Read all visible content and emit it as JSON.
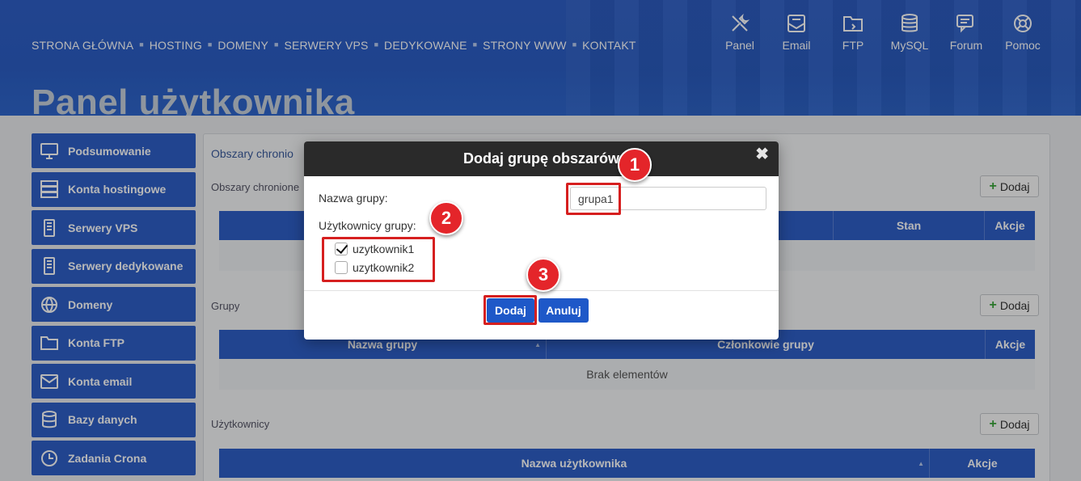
{
  "header": {
    "nav": [
      "STRONA GŁÓWNA",
      "HOSTING",
      "DOMENY",
      "SERWERY VPS",
      "DEDYKOWANE",
      "STRONY WWW",
      "KONTAKT"
    ],
    "icons": [
      {
        "label": "Panel",
        "icon": "tools-icon"
      },
      {
        "label": "Email",
        "icon": "email-icon"
      },
      {
        "label": "FTP",
        "icon": "ftp-folder-icon"
      },
      {
        "label": "MySQL",
        "icon": "database-icon"
      },
      {
        "label": "Forum",
        "icon": "forum-icon"
      },
      {
        "label": "Pomoc",
        "icon": "lifebuoy-icon"
      }
    ],
    "page_title": "Panel użytkownika"
  },
  "sidebar": {
    "items": [
      {
        "label": "Podsumowanie",
        "icon": "monitor-icon"
      },
      {
        "label": "Konta hostingowe",
        "icon": "server-rack-icon"
      },
      {
        "label": "Serwery VPS",
        "icon": "server-icon"
      },
      {
        "label": "Serwery dedykowane",
        "icon": "server-icon"
      },
      {
        "label": "Domeny",
        "icon": "globe-www-icon"
      },
      {
        "label": "Konta FTP",
        "icon": "ftp-folder-icon"
      },
      {
        "label": "Konta email",
        "icon": "email-icon"
      },
      {
        "label": "Bazy danych",
        "icon": "database-icon"
      },
      {
        "label": "Zadania Crona",
        "icon": "clock-icon"
      }
    ]
  },
  "main": {
    "title": "Obszary chronio",
    "areas": {
      "label": "Obszary chronione",
      "add_label": "Dodaj",
      "columns": [
        "Stan",
        "Akcje"
      ]
    },
    "groups": {
      "label": "Grupy",
      "add_label": "Dodaj",
      "columns": [
        "Nazwa grupy",
        "Członkowie grupy",
        "Akcje"
      ],
      "empty": "Brak elementów"
    },
    "users": {
      "label": "Użytkownicy",
      "add_label": "Dodaj",
      "columns": [
        "Nazwa użytkownika",
        "Akcje"
      ]
    }
  },
  "modal": {
    "title": "Dodaj grupę obszarów",
    "close": "✖",
    "name_label": "Nazwa grupy:",
    "name_value": "grupa1",
    "users_label": "Użytkownicy grupy:",
    "users": [
      {
        "name": "uzytkownik1",
        "checked": true
      },
      {
        "name": "uzytkownik2",
        "checked": false
      }
    ],
    "submit_label": "Dodaj",
    "cancel_label": "Anuluj"
  },
  "annotations": [
    "1",
    "2",
    "3"
  ],
  "colors": {
    "brand_blue": "#2f5fc6",
    "button_blue": "#1e58c8",
    "highlight_red": "#d61f1f",
    "badge_red": "#e4252a",
    "modal_header": "#2a2a2a"
  }
}
